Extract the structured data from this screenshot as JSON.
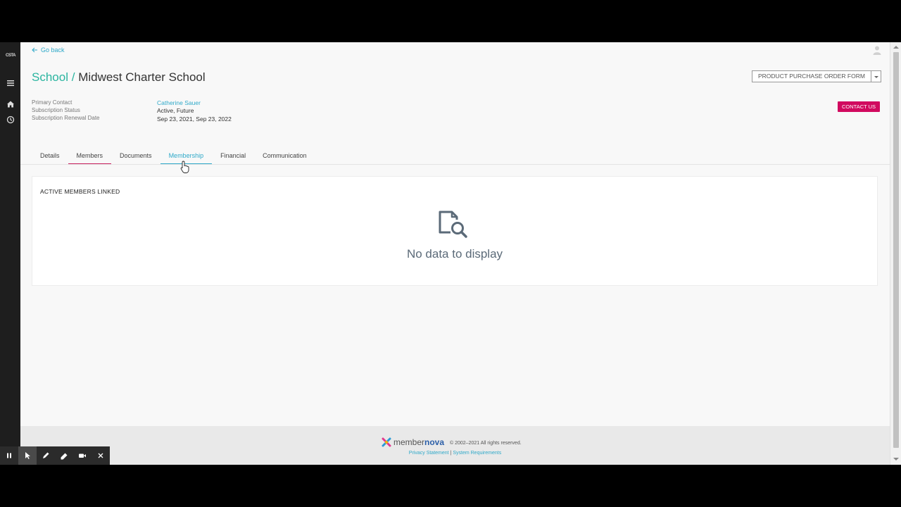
{
  "rail": {
    "logo": "CSTA",
    "icons": [
      "menu-icon",
      "home-icon",
      "clock-icon"
    ]
  },
  "header": {
    "go_back": "Go back",
    "title_crumb": "School",
    "title_separator": "/",
    "title_name": "Midwest Charter School",
    "order_form_button": "PRODUCT PURCHASE ORDER FORM",
    "contact_button": "CONTACT US"
  },
  "info": {
    "primary_contact_label": "Primary Contact",
    "primary_contact_value": "Catherine Sauer",
    "subscription_status_label": "Subscription Status",
    "subscription_status_value": "Active, Future",
    "renewal_date_label": "Subscription Renewal Date",
    "renewal_date_value": "Sep 23, 2021, Sep 23, 2022"
  },
  "tabs": [
    {
      "label": "Details"
    },
    {
      "label": "Members"
    },
    {
      "label": "Documents"
    },
    {
      "label": "Membership"
    },
    {
      "label": "Financial"
    },
    {
      "label": "Communication"
    }
  ],
  "panel": {
    "title": "ACTIVE MEMBERS LINKED",
    "empty_message": "No data to display",
    "empty_icon": "document-search-icon"
  },
  "footer": {
    "brand_prefix": "member",
    "brand_suffix": "nova",
    "copyright": "© 2002–2021  All rights reserved.",
    "privacy_link": "Privacy Statement",
    "link_separator": "|",
    "requirements_link": "System Requirements"
  },
  "colors": {
    "accent_teal": "#2bb5a0",
    "link_blue": "#2fa9c9",
    "contact_pink": "#d10a5f",
    "tab_pink": "#c8205e"
  }
}
